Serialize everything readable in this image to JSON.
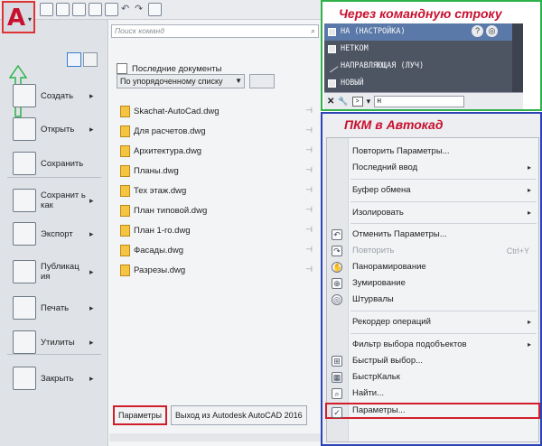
{
  "left_menu": {
    "search_placeholder": "Поиск команд",
    "recent_title": "Последние документы",
    "sort_option": "По упорядоченному списку",
    "items": [
      {
        "label": "Создать",
        "has_sub": "▸"
      },
      {
        "label": "Открыть",
        "has_sub": "▸"
      },
      {
        "label": "Сохранить",
        "has_sub": ""
      },
      {
        "label": "Сохранит ь как",
        "has_sub": "▸"
      },
      {
        "label": "Экспорт",
        "has_sub": "▸"
      },
      {
        "label": "Публикац ия",
        "has_sub": "▸"
      },
      {
        "label": "Печать",
        "has_sub": "▸"
      },
      {
        "label": "Утилиты",
        "has_sub": "▸"
      },
      {
        "label": "Закрыть",
        "has_sub": "▸"
      }
    ],
    "files": [
      "Skachat-AutoCad.dwg",
      "Для расчетов.dwg",
      "Архитектура.dwg",
      "Планы.dwg",
      "Тех этаж.dwg",
      "План типовой.dwg",
      "План 1-го.dwg",
      "Фасады.dwg",
      "Разрезы.dwg"
    ],
    "params_button": "Параметры",
    "exit_button": "Выход из Autodesk AutoCAD 2016"
  },
  "command_line": {
    "title": "Через командную строку",
    "rows": [
      "НА (НАСТРОЙКА)",
      "НЕТКОМ",
      "НАПРАВЛЯЮЩАЯ (ЛУЧ)",
      "НОВЫЙ"
    ],
    "input_value": "н",
    "help_icon": "?"
  },
  "context_menu": {
    "title": "ПКМ в Автокад",
    "items": [
      {
        "label": "Повторить Параметры...",
        "sub": "",
        "shortcut": "",
        "disabled": false,
        "icon": ""
      },
      {
        "label": "Последний ввод",
        "sub": "▸",
        "shortcut": "",
        "disabled": false,
        "icon": ""
      },
      {
        "label": "Буфер обмена",
        "sub": "▸",
        "shortcut": "",
        "disabled": false,
        "icon": ""
      },
      {
        "label": "Изолировать",
        "sub": "▸",
        "shortcut": "",
        "disabled": false,
        "icon": ""
      },
      {
        "label": "Отменить Параметры...",
        "sub": "",
        "shortcut": "",
        "disabled": false,
        "icon": "undo"
      },
      {
        "label": "Повторить",
        "sub": "",
        "shortcut": "Ctrl+Y",
        "disabled": true,
        "icon": "redo"
      },
      {
        "label": "Панорамирование",
        "sub": "",
        "shortcut": "",
        "disabled": false,
        "icon": "pan"
      },
      {
        "label": "Зумирование",
        "sub": "",
        "shortcut": "",
        "disabled": false,
        "icon": "zoom"
      },
      {
        "label": "Штурвалы",
        "sub": "",
        "shortcut": "",
        "disabled": false,
        "icon": "wheel"
      },
      {
        "label": "Рекордер операций",
        "sub": "▸",
        "shortcut": "",
        "disabled": false,
        "icon": ""
      },
      {
        "label": "Фильтр выбора подобъектов",
        "sub": "▸",
        "shortcut": "",
        "disabled": false,
        "icon": ""
      },
      {
        "label": "Быстрый выбор...",
        "sub": "",
        "shortcut": "",
        "disabled": false,
        "icon": "qselect"
      },
      {
        "label": "БыстрКальк",
        "sub": "",
        "shortcut": "",
        "disabled": false,
        "icon": "calc"
      },
      {
        "label": "Найти...",
        "sub": "",
        "shortcut": "",
        "disabled": false,
        "icon": "find"
      },
      {
        "label": "Параметры...",
        "sub": "",
        "shortcut": "",
        "disabled": false,
        "icon": "check"
      }
    ]
  },
  "colors": {
    "highlight_red": "#d01f2a",
    "green_frame": "#2fb24a",
    "blue_frame": "#2b43b5",
    "title_red": "#c8102e"
  }
}
